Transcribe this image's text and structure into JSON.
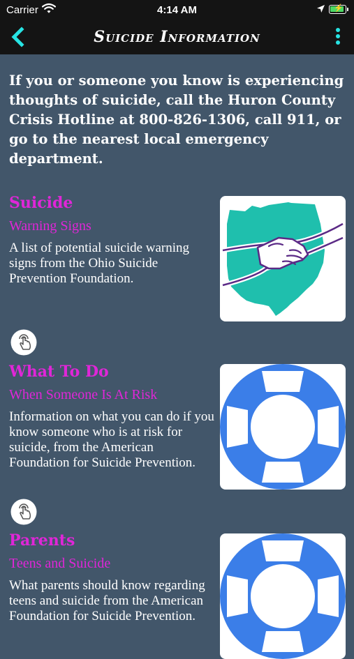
{
  "status_bar": {
    "carrier": "Carrier",
    "time": "4:14 AM"
  },
  "nav": {
    "title": "Suicide Information",
    "accent_color": "#27e3e3"
  },
  "intro": "If you or someone you know is experiencing thoughts of suicide, call the Huron County Crisis Hotline at 800-826-1306, call 911, or go to the nearest local emergency department.",
  "cards": [
    {
      "title": "Suicide",
      "subtitle": "Warning Signs",
      "description": "A list of potential suicide warning signs from the Ohio Suicide Prevention Foundation.",
      "image_icon": "ohio-handshake-icon"
    },
    {
      "title": "What To Do",
      "subtitle": "When Someone Is At Risk",
      "description": "Information on what you can do if you know someone who is at risk for suicide, from the American Foundation for Suicide Prevention.",
      "image_icon": "life-preserver-icon"
    },
    {
      "title": "Parents",
      "subtitle": "Teens and Suicide",
      "description": "What parents should know regarding teens and suicide from the American Foundation for Suicide Prevention.",
      "image_icon": "life-preserver-icon"
    }
  ],
  "colors": {
    "background": "#42566a",
    "bar": "#141414",
    "title_accent": "#e026d8",
    "ohio_teal": "#1fbfad",
    "preserver_blue": "#3b7ee8"
  }
}
